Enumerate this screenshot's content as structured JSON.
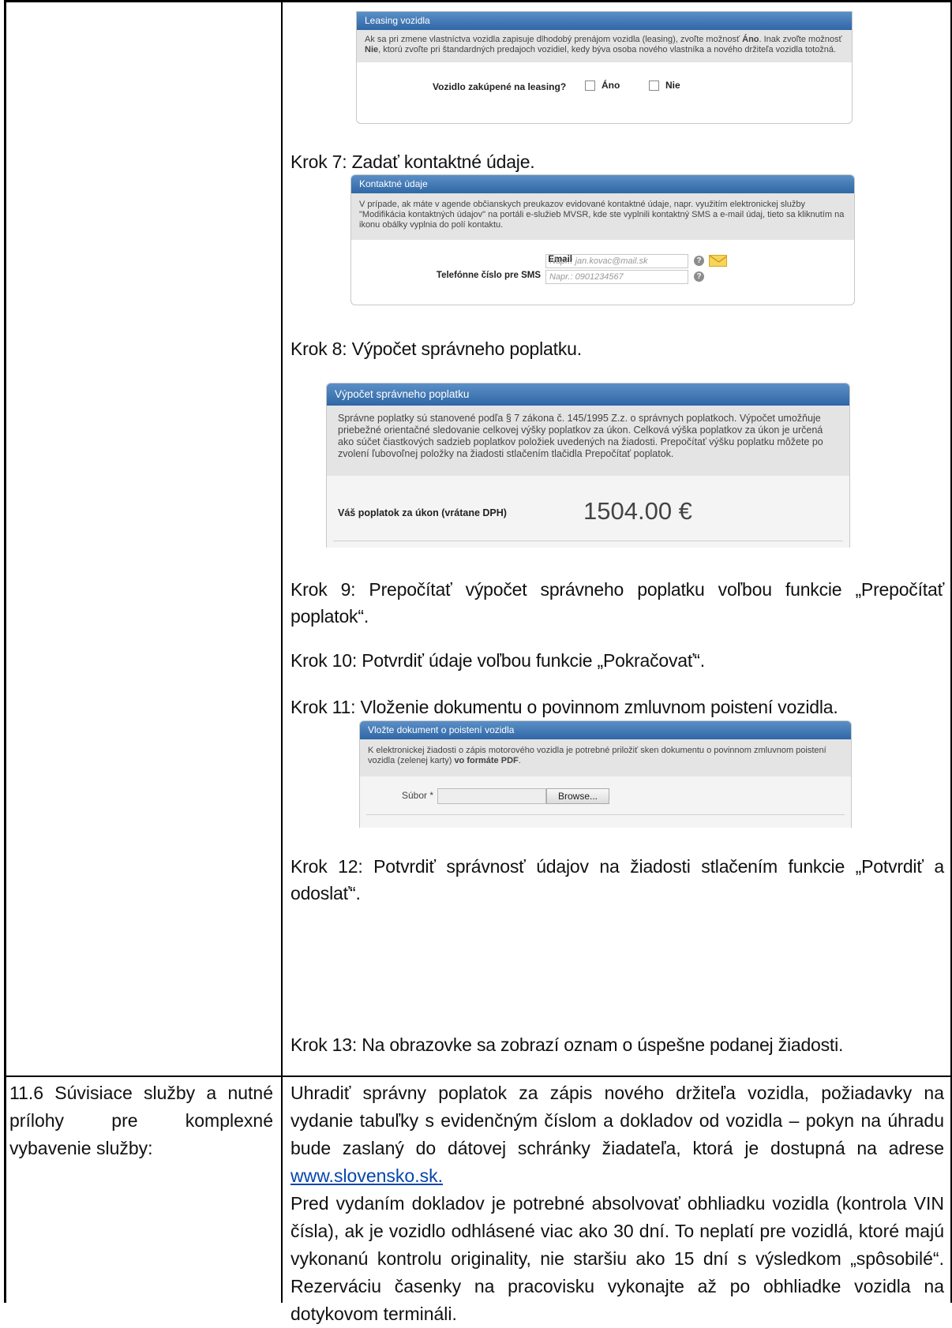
{
  "leasing_panel": {
    "title": "Leasing vozidla",
    "desc_a": "Ak sa pri zmene vlastníctva vozidla zapisuje dlhodobý prenájom vozidla (leasing), zvoľte možnosť ",
    "desc_b": "Áno",
    "desc_c": ". Inak zvoľte možnosť ",
    "desc_d": "Nie",
    "desc_e": ", ktorú zvoľte pri štandardných predajoch vozidiel, kedy býva osoba nového vlastníka a nového držiteľa vozidla totožná.",
    "question": "Vozidlo zakúpené na leasing?",
    "option_yes": "Áno",
    "option_no": "Nie"
  },
  "step7": "Krok 7: Zadať kontaktné údaje.",
  "contact_panel": {
    "title": "Kontaktné údaje",
    "desc": "V prípade, ak máte v agende občianskych preukazov evidované kontaktné údaje, napr. využitím elektronickej služby \"Modifikácia kontaktných údajov\" na portáli e-služieb MVSR, kde ste vyplnili kontaktný SMS a e-mail údaj, tieto sa kliknutím na ikonu obálky vyplnia do polí kontaktu.",
    "email_label": "Email",
    "email_placeholder": "Napr.: jan.kovac@mail.sk",
    "sms_label": "Telefónne číslo pre SMS",
    "sms_placeholder": "Napr.: 0901234567",
    "help_glyph": "?"
  },
  "step8": "Krok 8: Výpočet správneho poplatku.",
  "fee_panel": {
    "title": "Výpočet správneho poplatku",
    "desc": "Správne poplatky sú stanovené podľa § 7 zákona č. 145/1995 Z.z. o správnych poplatkoch. Výpočet umožňuje priebežné orientačné sledovanie celkovej výšky poplatkov za úkon. Celková výška poplatkov za úkon je určená ako súčet čiastkových sadzieb poplatkov položiek uvedených na žiadosti. Prepočítať výšku poplatku môžete po zvolení ľubovoľnej položky na žiadosti stlačením tlačidla Prepočítať poplatok.",
    "fee_label": "Váš poplatok za úkon (vrátane DPH)",
    "fee_value": "1504.00 €"
  },
  "step9": "Krok 9: Prepočítať výpočet správneho poplatku voľbou funkcie „Prepočítať poplatok“.",
  "step10": "Krok 10: Potvrdiť údaje voľbou funkcie „Pokračovať“.",
  "step11": "Krok 11: Vloženie dokumentu o povinnom zmluvnom poistení vozidla.",
  "insurance_panel": {
    "title": "Vložte dokument o poistení vozidla",
    "desc_a": "K elektronickej žiadosti o zápis motorového vozidla je potrebné priložiť sken dokumentu o povinnom zmluvnom poistení vozidla (zelenej karty) ",
    "desc_b": "vo formáte PDF",
    "desc_c": ".",
    "file_label": "Súbor *",
    "browse_label": "Browse..."
  },
  "step12": "Krok 12: Potvrdiť správnosť údajov na žiadosti stlačením funkcie „Potvrdiť a odoslať“.",
  "step13": "Krok 13: Na obrazovke sa zobrazí oznam o úspešne podanej žiadosti.",
  "row_116": {
    "label": "11.6 Súvisiace služby a nutné prílohy pre komplexné vybavenie služby:",
    "para1_text": "Uhradiť správny poplatok za zápis nového držiteľa vozidla, požiadavky na vydanie tabuľky s evidenčným číslom a dokladov od vozidla – pokyn na úhradu bude zaslaný do dátovej schránky žiadateľa, ktorá je dostupná na adrese ",
    "para1_link": "www.slovensko.sk.",
    "para2": "Pred vydaním dokladov je potrebné absolvovať obhliadku vozidla (kontrola VIN čísla), ak je vozidlo odhlásené viac ako 30 dní. To neplatí pre vozidlá, ktoré majú vykonanú kontrolu originality, nie staršiu ako 15 dní s výsledkom „spôsobilé“. Rezerváciu časenky na pracovisku vykonajte až po obhliadke vozidla na dotykovom termináli."
  }
}
